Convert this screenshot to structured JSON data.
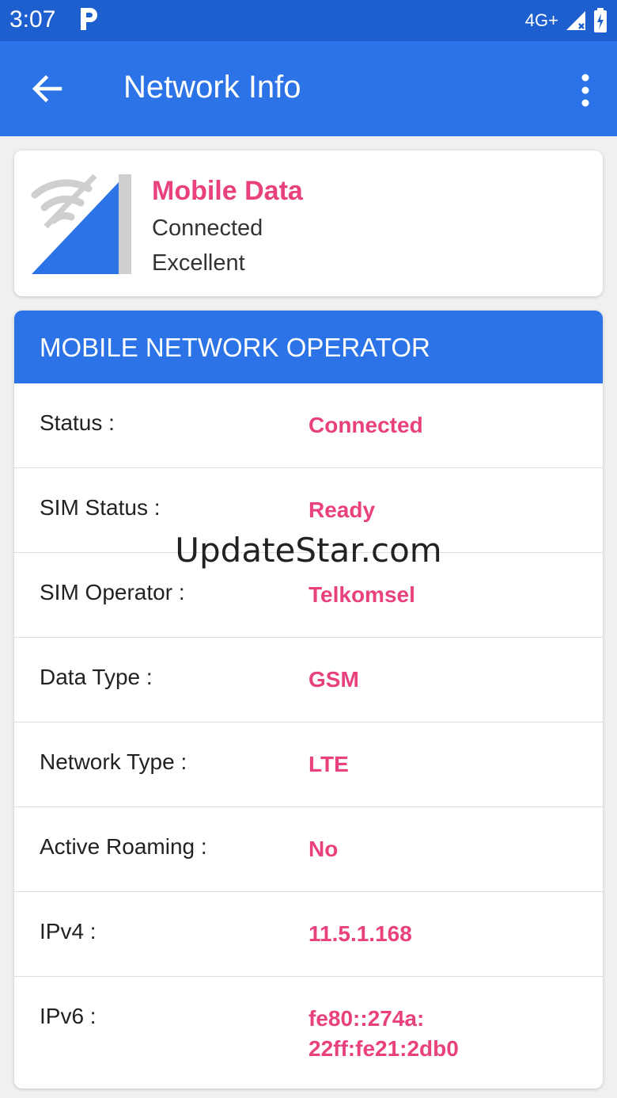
{
  "status_bar": {
    "time": "3:07",
    "network_label": "4G+",
    "icons": [
      "parking-p-icon",
      "signal-icon",
      "battery-icon"
    ]
  },
  "app_bar": {
    "title": "Network Info",
    "back_icon": "arrow-back-icon",
    "menu_icon": "overflow-menu-icon"
  },
  "connection_card": {
    "icon": "mobile-data-signal-icon",
    "title": "Mobile Data",
    "status": "Connected",
    "quality": "Excellent"
  },
  "operator_section": {
    "header": "MOBILE NETWORK OPERATOR",
    "rows": [
      {
        "label": "Status :",
        "value": "Connected"
      },
      {
        "label": "SIM Status :",
        "value": "Ready"
      },
      {
        "label": "SIM Operator :",
        "value": "Telkomsel"
      },
      {
        "label": "Data Type :",
        "value": "GSM"
      },
      {
        "label": "Network Type :",
        "value": "LTE"
      },
      {
        "label": "Active Roaming :",
        "value": "No"
      },
      {
        "label": "IPv4 :",
        "value": "11.5.1.168"
      },
      {
        "label": "IPv6 :",
        "value": "fe80::274a:\n22ff:fe21:2db0"
      }
    ]
  },
  "watermark": "UpdateStar.com",
  "colors": {
    "status_bar": "#1d5fcf",
    "app_bar": "#2b73e6",
    "accent_pink": "#e9417e",
    "background": "#f0f0f0"
  }
}
